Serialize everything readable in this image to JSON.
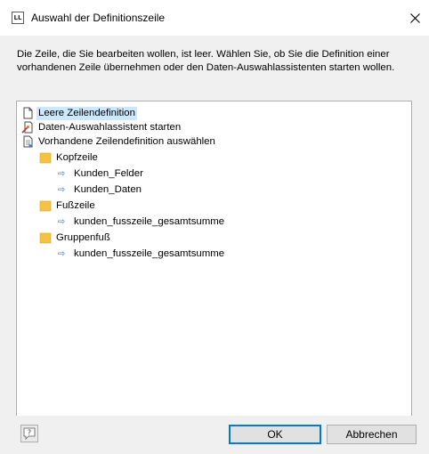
{
  "window": {
    "app_icon_text": "LL",
    "title": "Auswahl der Definitionszeile"
  },
  "description": "Die Zeile, die Sie bearbeiten wollen, ist leer. Wählen Sie, ob Sie die Definition einer vorhandenen Zeile übernehmen oder den Daten-Auswahlassistenten starten wollen.",
  "tree": {
    "items": [
      {
        "label": "Leere Zeilendefinition",
        "icon": "blank-document-icon",
        "selected": true
      },
      {
        "label": "Daten-Auswahlassistent starten",
        "icon": "wizard-document-icon"
      },
      {
        "label": "Vorhandene Zeilendefinition auswählen",
        "icon": "document-select-icon"
      },
      {
        "label": "Kopfzeile",
        "icon": "folder-icon"
      },
      {
        "label": "Kunden_Felder",
        "icon": "arrow-link-icon"
      },
      {
        "label": "Kunden_Daten",
        "icon": "arrow-link-icon"
      },
      {
        "label": "Fußzeile",
        "icon": "folder-icon"
      },
      {
        "label": "kunden_fusszeile_gesamtsumme",
        "icon": "arrow-link-icon"
      },
      {
        "label": "Gruppenfuß",
        "icon": "folder-icon"
      },
      {
        "label": "kunden_fusszeile_gesamtsumme",
        "icon": "arrow-link-icon"
      }
    ]
  },
  "buttons": {
    "help": "?",
    "ok": "OK",
    "cancel": "Abbrechen"
  },
  "colors": {
    "selection": "#cce8ff",
    "folder": "#f5c242",
    "default_button_border": "#0078d7"
  }
}
